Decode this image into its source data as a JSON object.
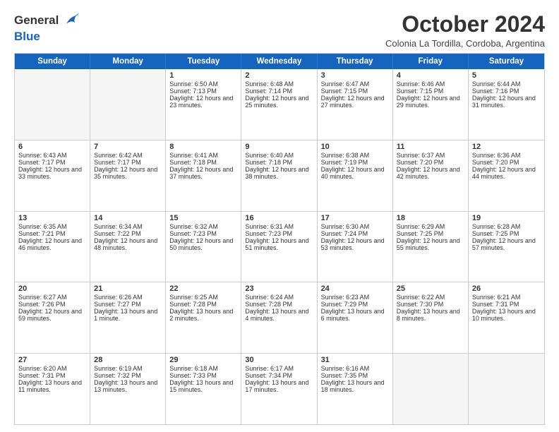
{
  "header": {
    "logo_general": "General",
    "logo_blue": "Blue",
    "month_title": "October 2024",
    "location": "Colonia La Tordilla, Cordoba, Argentina"
  },
  "days_of_week": [
    "Sunday",
    "Monday",
    "Tuesday",
    "Wednesday",
    "Thursday",
    "Friday",
    "Saturday"
  ],
  "weeks": [
    [
      {
        "day": "",
        "sunrise": "",
        "sunset": "",
        "daylight": "",
        "empty": true
      },
      {
        "day": "",
        "sunrise": "",
        "sunset": "",
        "daylight": "",
        "empty": true
      },
      {
        "day": "1",
        "sunrise": "Sunrise: 6:50 AM",
        "sunset": "Sunset: 7:13 PM",
        "daylight": "Daylight: 12 hours and 23 minutes.",
        "empty": false
      },
      {
        "day": "2",
        "sunrise": "Sunrise: 6:48 AM",
        "sunset": "Sunset: 7:14 PM",
        "daylight": "Daylight: 12 hours and 25 minutes.",
        "empty": false
      },
      {
        "day": "3",
        "sunrise": "Sunrise: 6:47 AM",
        "sunset": "Sunset: 7:15 PM",
        "daylight": "Daylight: 12 hours and 27 minutes.",
        "empty": false
      },
      {
        "day": "4",
        "sunrise": "Sunrise: 6:46 AM",
        "sunset": "Sunset: 7:15 PM",
        "daylight": "Daylight: 12 hours and 29 minutes.",
        "empty": false
      },
      {
        "day": "5",
        "sunrise": "Sunrise: 6:44 AM",
        "sunset": "Sunset: 7:16 PM",
        "daylight": "Daylight: 12 hours and 31 minutes.",
        "empty": false
      }
    ],
    [
      {
        "day": "6",
        "sunrise": "Sunrise: 6:43 AM",
        "sunset": "Sunset: 7:17 PM",
        "daylight": "Daylight: 12 hours and 33 minutes.",
        "empty": false
      },
      {
        "day": "7",
        "sunrise": "Sunrise: 6:42 AM",
        "sunset": "Sunset: 7:17 PM",
        "daylight": "Daylight: 12 hours and 35 minutes.",
        "empty": false
      },
      {
        "day": "8",
        "sunrise": "Sunrise: 6:41 AM",
        "sunset": "Sunset: 7:18 PM",
        "daylight": "Daylight: 12 hours and 37 minutes.",
        "empty": false
      },
      {
        "day": "9",
        "sunrise": "Sunrise: 6:40 AM",
        "sunset": "Sunset: 7:18 PM",
        "daylight": "Daylight: 12 hours and 38 minutes.",
        "empty": false
      },
      {
        "day": "10",
        "sunrise": "Sunrise: 6:38 AM",
        "sunset": "Sunset: 7:19 PM",
        "daylight": "Daylight: 12 hours and 40 minutes.",
        "empty": false
      },
      {
        "day": "11",
        "sunrise": "Sunrise: 6:37 AM",
        "sunset": "Sunset: 7:20 PM",
        "daylight": "Daylight: 12 hours and 42 minutes.",
        "empty": false
      },
      {
        "day": "12",
        "sunrise": "Sunrise: 6:36 AM",
        "sunset": "Sunset: 7:20 PM",
        "daylight": "Daylight: 12 hours and 44 minutes.",
        "empty": false
      }
    ],
    [
      {
        "day": "13",
        "sunrise": "Sunrise: 6:35 AM",
        "sunset": "Sunset: 7:21 PM",
        "daylight": "Daylight: 12 hours and 46 minutes.",
        "empty": false
      },
      {
        "day": "14",
        "sunrise": "Sunrise: 6:34 AM",
        "sunset": "Sunset: 7:22 PM",
        "daylight": "Daylight: 12 hours and 48 minutes.",
        "empty": false
      },
      {
        "day": "15",
        "sunrise": "Sunrise: 6:32 AM",
        "sunset": "Sunset: 7:23 PM",
        "daylight": "Daylight: 12 hours and 50 minutes.",
        "empty": false
      },
      {
        "day": "16",
        "sunrise": "Sunrise: 6:31 AM",
        "sunset": "Sunset: 7:23 PM",
        "daylight": "Daylight: 12 hours and 51 minutes.",
        "empty": false
      },
      {
        "day": "17",
        "sunrise": "Sunrise: 6:30 AM",
        "sunset": "Sunset: 7:24 PM",
        "daylight": "Daylight: 12 hours and 53 minutes.",
        "empty": false
      },
      {
        "day": "18",
        "sunrise": "Sunrise: 6:29 AM",
        "sunset": "Sunset: 7:25 PM",
        "daylight": "Daylight: 12 hours and 55 minutes.",
        "empty": false
      },
      {
        "day": "19",
        "sunrise": "Sunrise: 6:28 AM",
        "sunset": "Sunset: 7:25 PM",
        "daylight": "Daylight: 12 hours and 57 minutes.",
        "empty": false
      }
    ],
    [
      {
        "day": "20",
        "sunrise": "Sunrise: 6:27 AM",
        "sunset": "Sunset: 7:26 PM",
        "daylight": "Daylight: 12 hours and 59 minutes.",
        "empty": false
      },
      {
        "day": "21",
        "sunrise": "Sunrise: 6:26 AM",
        "sunset": "Sunset: 7:27 PM",
        "daylight": "Daylight: 13 hours and 1 minute.",
        "empty": false
      },
      {
        "day": "22",
        "sunrise": "Sunrise: 6:25 AM",
        "sunset": "Sunset: 7:28 PM",
        "daylight": "Daylight: 13 hours and 2 minutes.",
        "empty": false
      },
      {
        "day": "23",
        "sunrise": "Sunrise: 6:24 AM",
        "sunset": "Sunset: 7:28 PM",
        "daylight": "Daylight: 13 hours and 4 minutes.",
        "empty": false
      },
      {
        "day": "24",
        "sunrise": "Sunrise: 6:23 AM",
        "sunset": "Sunset: 7:29 PM",
        "daylight": "Daylight: 13 hours and 6 minutes.",
        "empty": false
      },
      {
        "day": "25",
        "sunrise": "Sunrise: 6:22 AM",
        "sunset": "Sunset: 7:30 PM",
        "daylight": "Daylight: 13 hours and 8 minutes.",
        "empty": false
      },
      {
        "day": "26",
        "sunrise": "Sunrise: 6:21 AM",
        "sunset": "Sunset: 7:31 PM",
        "daylight": "Daylight: 13 hours and 10 minutes.",
        "empty": false
      }
    ],
    [
      {
        "day": "27",
        "sunrise": "Sunrise: 6:20 AM",
        "sunset": "Sunset: 7:31 PM",
        "daylight": "Daylight: 13 hours and 11 minutes.",
        "empty": false
      },
      {
        "day": "28",
        "sunrise": "Sunrise: 6:19 AM",
        "sunset": "Sunset: 7:32 PM",
        "daylight": "Daylight: 13 hours and 13 minutes.",
        "empty": false
      },
      {
        "day": "29",
        "sunrise": "Sunrise: 6:18 AM",
        "sunset": "Sunset: 7:33 PM",
        "daylight": "Daylight: 13 hours and 15 minutes.",
        "empty": false
      },
      {
        "day": "30",
        "sunrise": "Sunrise: 6:17 AM",
        "sunset": "Sunset: 7:34 PM",
        "daylight": "Daylight: 13 hours and 17 minutes.",
        "empty": false
      },
      {
        "day": "31",
        "sunrise": "Sunrise: 6:16 AM",
        "sunset": "Sunset: 7:35 PM",
        "daylight": "Daylight: 13 hours and 18 minutes.",
        "empty": false
      },
      {
        "day": "",
        "sunrise": "",
        "sunset": "",
        "daylight": "",
        "empty": true
      },
      {
        "day": "",
        "sunrise": "",
        "sunset": "",
        "daylight": "",
        "empty": true
      }
    ]
  ]
}
